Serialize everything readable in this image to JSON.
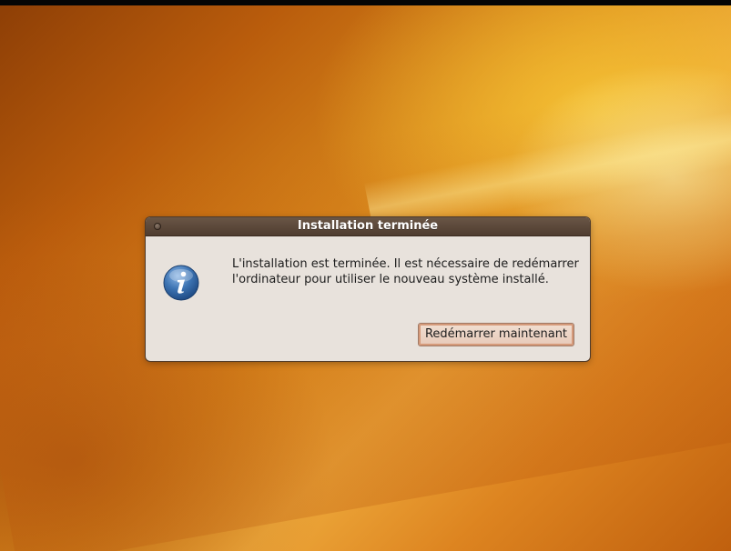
{
  "dialog": {
    "title": "Installation terminée",
    "message": "L'installation est terminée. Il est nécessaire de redémarrer l'ordinateur pour utiliser le nouveau système installé.",
    "icon": "info-icon",
    "restart_button_label": "Redémarrer maintenant"
  },
  "colors": {
    "titlebar": "#4f3d30",
    "dialog_background": "#e8e2dc",
    "button_focus": "#d59a7a",
    "info_icon_blue": "#3d74b3"
  }
}
